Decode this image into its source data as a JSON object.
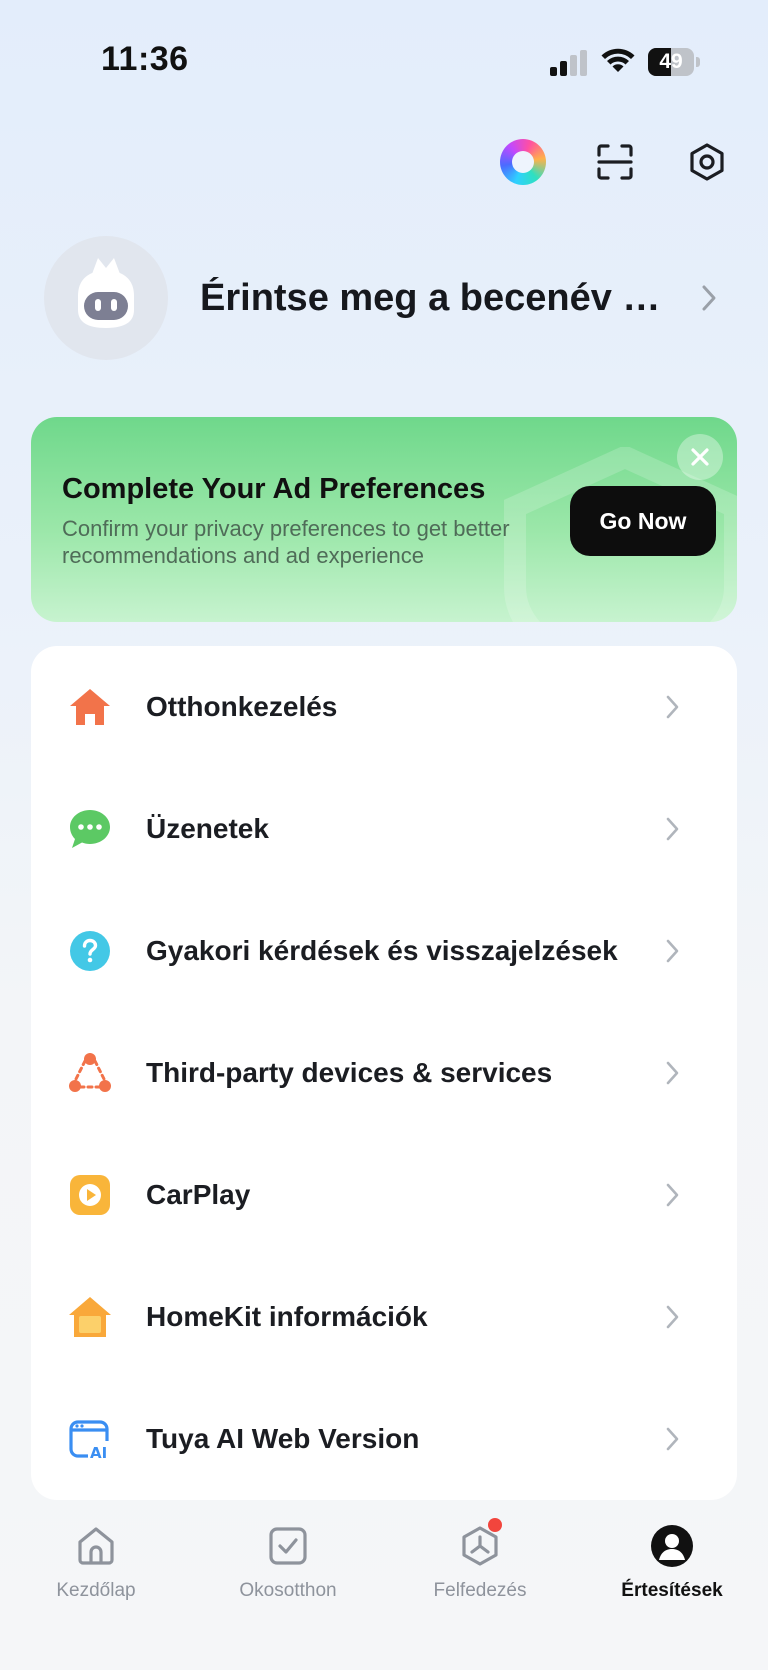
{
  "status_bar": {
    "time": "11:36",
    "battery": "49",
    "battery_level": 0.49
  },
  "profile": {
    "nickname": "Érintse meg a becenév me..."
  },
  "ad": {
    "title": "Complete Your Ad Preferences",
    "description": "Confirm your privacy preferences to get better recommendations and ad experience",
    "button": "Go Now"
  },
  "menu": {
    "items": [
      {
        "label": "Otthonkezelés",
        "icon": "home-icon",
        "color": "#f2734a"
      },
      {
        "label": "Üzenetek",
        "icon": "chat-bubble-icon",
        "color": "#5cc964"
      },
      {
        "label": "Gyakori kérdések és visszajelzések",
        "icon": "help-icon",
        "color": "#43c8e6"
      },
      {
        "label": "Third-party devices & services",
        "icon": "connections-icon",
        "color": "#f2734a"
      },
      {
        "label": "CarPlay",
        "icon": "carplay-icon",
        "color": "#f9b53a"
      },
      {
        "label": "HomeKit információk",
        "icon": "homekit-icon",
        "color": "#f9a83a"
      },
      {
        "label": "Tuya AI Web Version",
        "icon": "ai-web-icon",
        "color": "#3a8ef2"
      }
    ]
  },
  "nav": {
    "items": [
      {
        "label": "Kezdőlap",
        "icon": "home-outline-icon"
      },
      {
        "label": "Okosotthon",
        "icon": "smart-check-icon"
      },
      {
        "label": "Felfedezés",
        "icon": "explore-icon"
      },
      {
        "label": "Értesítések",
        "icon": "profile-icon",
        "active": true
      }
    ]
  }
}
